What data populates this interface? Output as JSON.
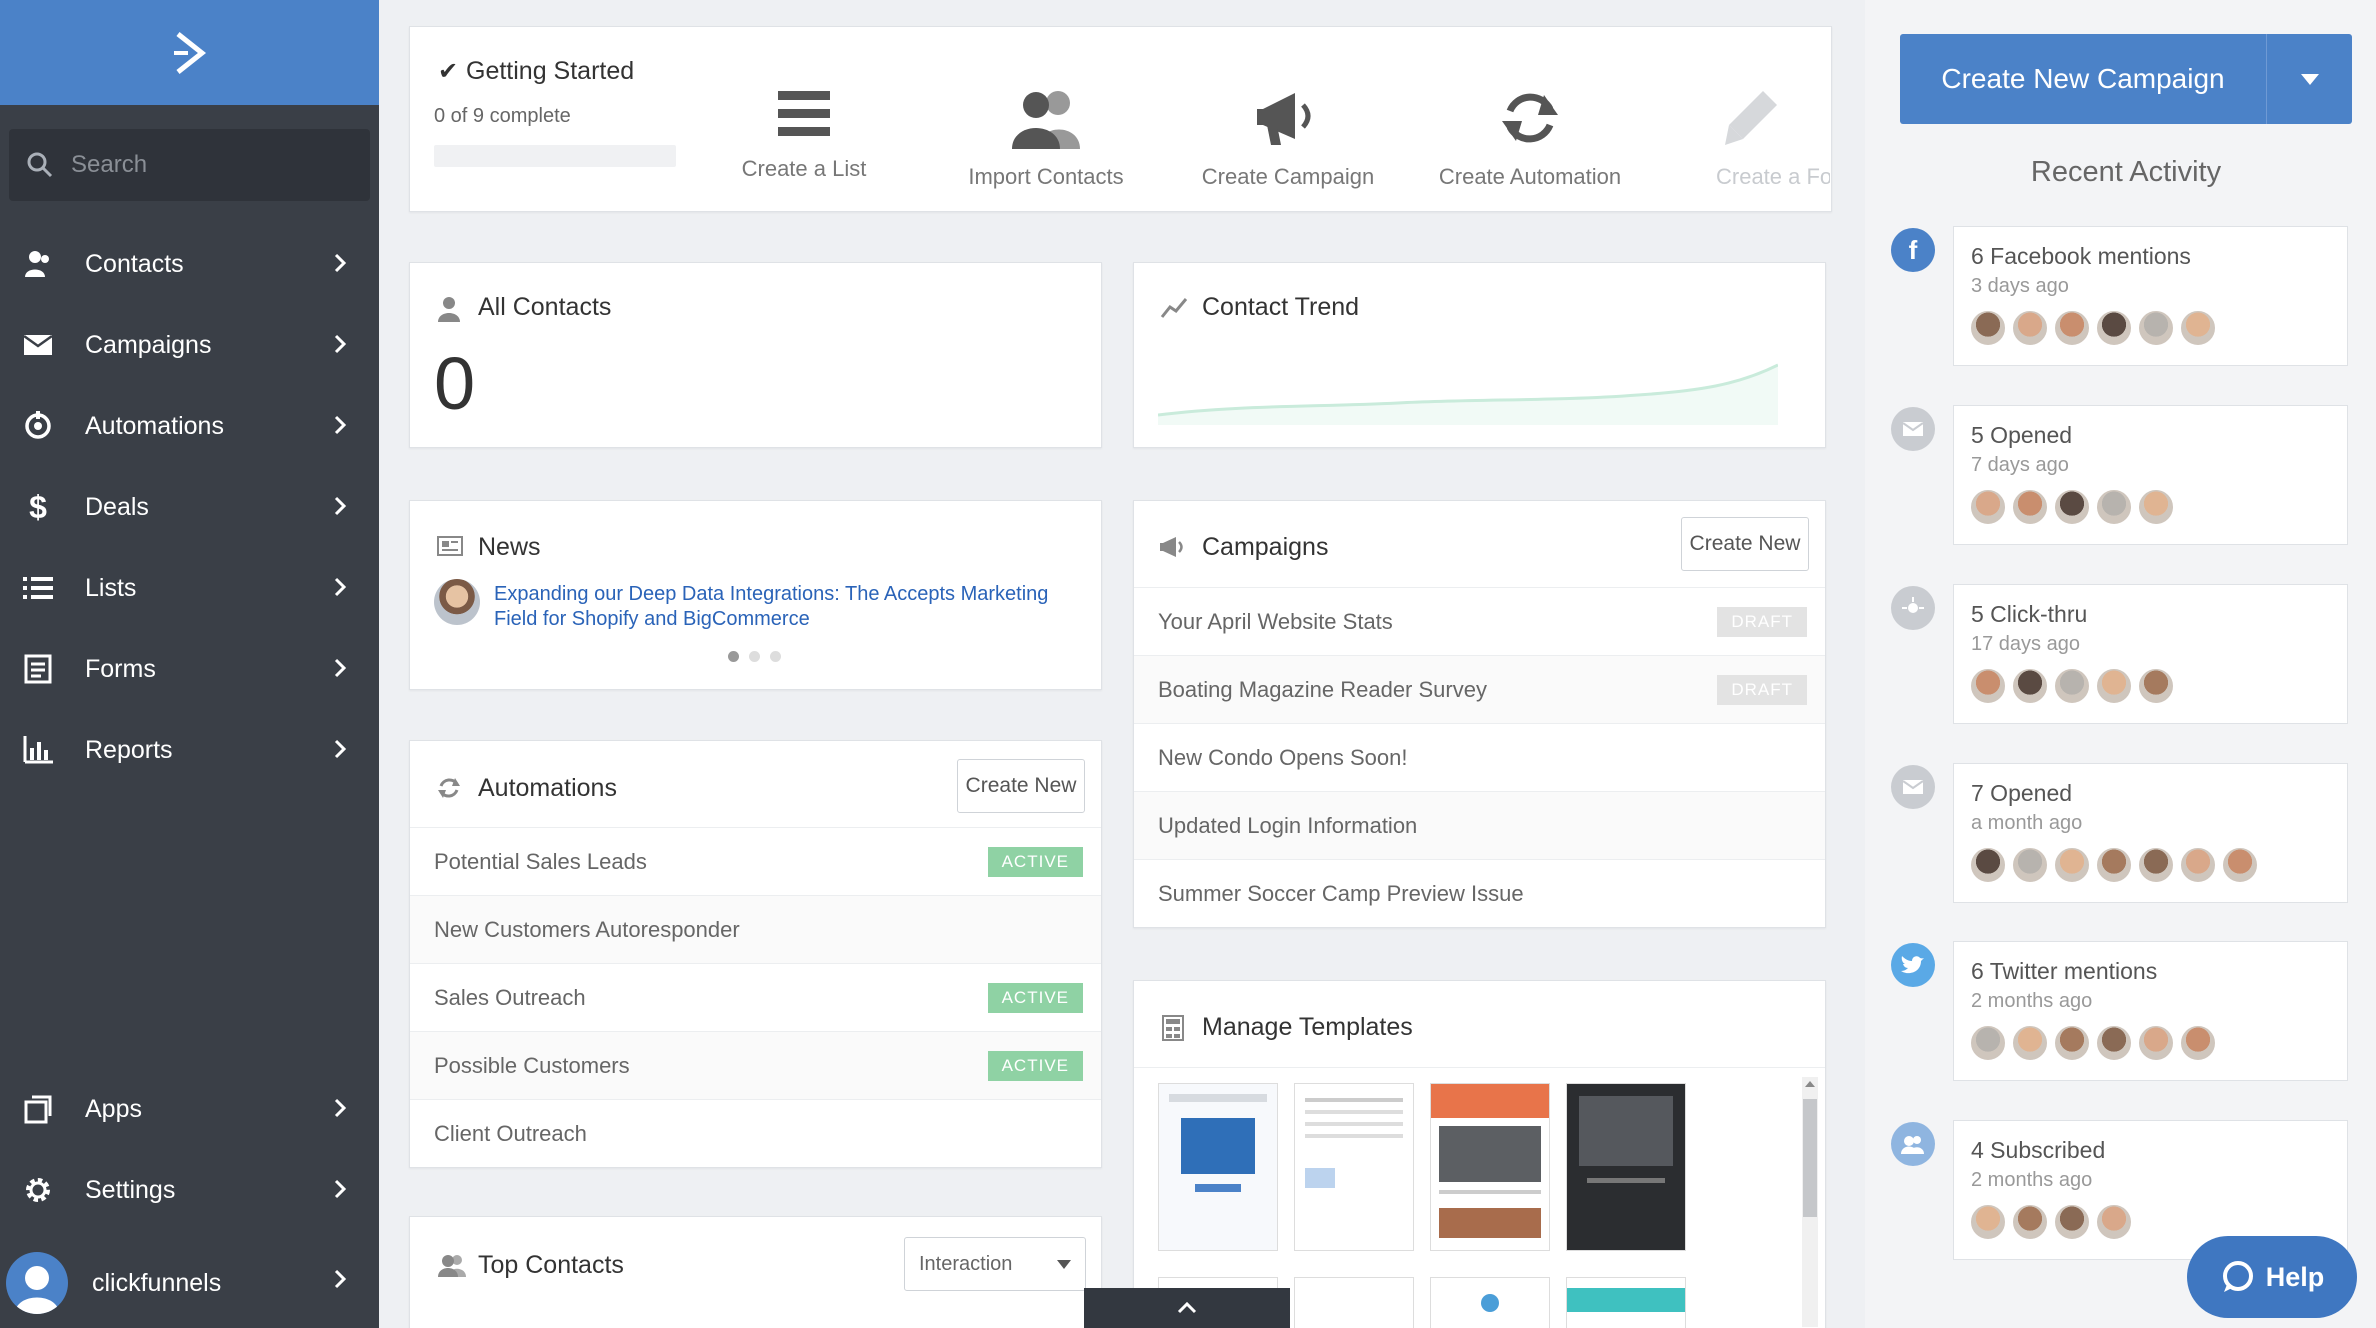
{
  "sidebar": {
    "search_placeholder": "Search",
    "items": [
      {
        "label": "Contacts",
        "icon": "contacts-icon"
      },
      {
        "label": "Campaigns",
        "icon": "envelope-icon"
      },
      {
        "label": "Automations",
        "icon": "automation-icon"
      },
      {
        "label": "Deals",
        "icon": "dollar-icon"
      },
      {
        "label": "Lists",
        "icon": "list-icon"
      },
      {
        "label": "Forms",
        "icon": "form-icon"
      },
      {
        "label": "Reports",
        "icon": "bar-chart-icon"
      }
    ],
    "bottom": [
      {
        "label": "Apps",
        "icon": "apps-icon"
      },
      {
        "label": "Settings",
        "icon": "gear-icon"
      }
    ],
    "user": "clickfunnels"
  },
  "getting_started": {
    "title": "Getting Started",
    "progress_text": "0 of 9 complete",
    "progress": 0,
    "steps": [
      "Create a List",
      "Import Contacts",
      "Create Campaign",
      "Create Automation",
      "Create a Fo"
    ]
  },
  "all_contacts": {
    "title": "All Contacts",
    "count": "0"
  },
  "contact_trend": {
    "title": "Contact Trend"
  },
  "news": {
    "title": "News",
    "headline_line1": "Expanding our Deep Data Integrations: The Accepts Marketing",
    "headline_line2": "Field for Shopify and BigCommerce"
  },
  "automations": {
    "title": "Automations",
    "create_label": "Create New",
    "rows": [
      {
        "name": "Potential Sales Leads",
        "status": "ACTIVE"
      },
      {
        "name": "New Customers Autoresponder",
        "status": ""
      },
      {
        "name": "Sales Outreach",
        "status": "ACTIVE"
      },
      {
        "name": "Possible Customers",
        "status": "ACTIVE"
      },
      {
        "name": "Client Outreach",
        "status": ""
      }
    ]
  },
  "campaigns": {
    "title": "Campaigns",
    "create_label": "Create New",
    "rows": [
      {
        "name": "Your April Website Stats",
        "status": "DRAFT"
      },
      {
        "name": "Boating Magazine Reader Survey",
        "status": "DRAFT"
      },
      {
        "name": "New Condo Opens Soon!",
        "status": ""
      },
      {
        "name": "Updated Login Information",
        "status": ""
      },
      {
        "name": "Summer Soccer Camp Preview Issue",
        "status": ""
      }
    ]
  },
  "templates": {
    "title": "Manage Templates"
  },
  "top_contacts": {
    "title": "Top Contacts",
    "filter": "Interaction"
  },
  "right": {
    "cta_label": "Create New Campaign",
    "recent_title": "Recent Activity",
    "activities": [
      {
        "title": "6 Facebook mentions",
        "time": "3 days ago",
        "icon": "facebook-icon",
        "color": "#4b82c8",
        "avatars": 6
      },
      {
        "title": "5 Opened",
        "time": "7 days ago",
        "icon": "envelope-icon",
        "color": "#c9ccd1",
        "avatars": 5
      },
      {
        "title": "5 Click-thru",
        "time": "17 days ago",
        "icon": "click-icon",
        "color": "#c9ccd1",
        "avatars": 5
      },
      {
        "title": "7 Opened",
        "time": "a month ago",
        "icon": "envelope-icon",
        "color": "#c9ccd1",
        "avatars": 7
      },
      {
        "title": "6 Twitter mentions",
        "time": "2 months ago",
        "icon": "twitter-icon",
        "color": "#5aa9e6",
        "avatars": 6
      },
      {
        "title": "4 Subscribed",
        "time": "2 months ago",
        "icon": "subscribe-icon",
        "color": "#8fb5e0",
        "avatars": 4
      }
    ],
    "help_label": "Help"
  }
}
